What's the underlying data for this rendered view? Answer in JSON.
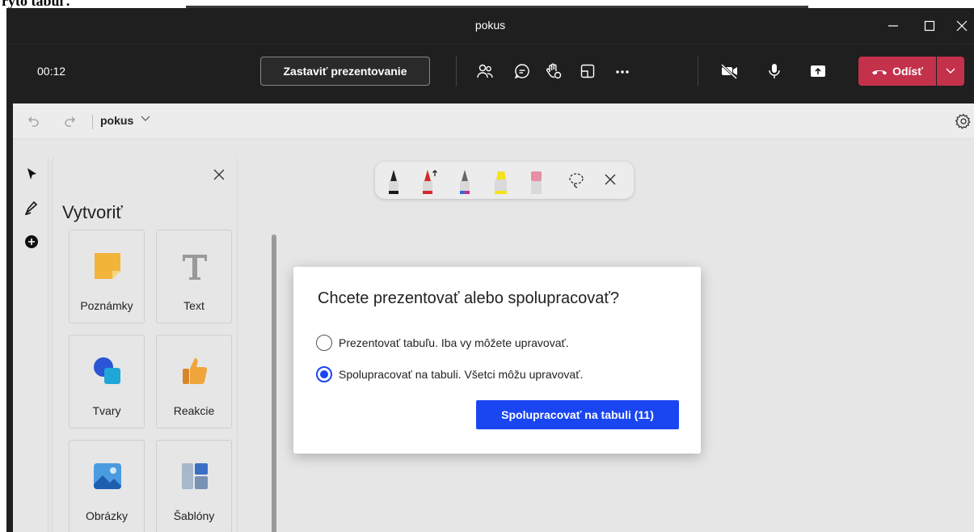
{
  "window": {
    "title": "pokus",
    "top_cropped_text": "ryto tabuľ."
  },
  "toolbar": {
    "timer": "00:12",
    "stop_presenting_label": "Zastaviť prezentovanie",
    "leave_label": "Odísť",
    "accent_leave": "#c4314b"
  },
  "board": {
    "name": "pokus"
  },
  "create_panel": {
    "title": "Vytvoriť",
    "tiles": [
      {
        "label": "Poznámky"
      },
      {
        "label": "Text"
      },
      {
        "label": "Tvary"
      },
      {
        "label": "Reakcie"
      },
      {
        "label": "Obrázky"
      },
      {
        "label": "Šablóny"
      }
    ]
  },
  "pens": [
    {
      "name": "black-pen",
      "color": "#1a1a1a"
    },
    {
      "name": "red-arrow-pen",
      "color": "#d62828"
    },
    {
      "name": "rainbow-pen",
      "color": "#7a4fc4"
    },
    {
      "name": "highlighter",
      "color": "#f4e21a"
    },
    {
      "name": "eraser",
      "color": "#e88ea6"
    }
  ],
  "dialog": {
    "title": "Chcete prezentovať alebo spolupracovať?",
    "option_present": "Prezentovať tabuľu. Iba vy môžete upravovať.",
    "option_collaborate": "Spolupracovať na tabuli. Všetci môžu upravovať.",
    "selected": "collaborate",
    "primary_button": "Spolupracovať na tabuli (11)",
    "accent": "#1a46f2"
  }
}
